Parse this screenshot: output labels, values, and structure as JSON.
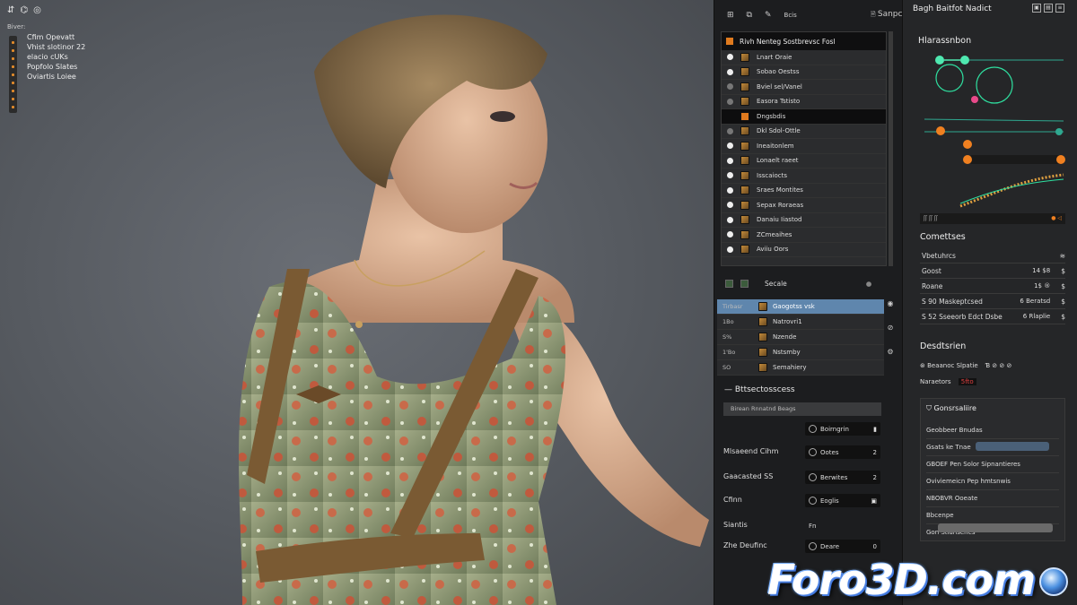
{
  "viewport": {
    "toolbar": [
      "⇵",
      "⌬",
      "◎"
    ],
    "info_header": "Biver:",
    "info_lines": [
      "Cfim Opevatt",
      "Vhist slotinor 22",
      "elacio cUKs",
      "Popfolo Slates",
      "Oviartis Loiee"
    ]
  },
  "outliner": {
    "toolbar_right": "Sanpcr",
    "toolbar_label": "Bcis",
    "list_header": "Rivh Nenteg Sostbrevsc Fosl",
    "rows": [
      {
        "label": "Lnart Oraie",
        "dot": "on"
      },
      {
        "label": "Sobao Oestss",
        "dot": "on"
      },
      {
        "label": "Bviel sel/Vanel",
        "dot": "dim"
      },
      {
        "label": "Easora Tstisto",
        "dot": "dim"
      },
      {
        "label": "Dngsbdis",
        "dot": "none",
        "selected": true
      },
      {
        "label": "Dkl Sdol-Ottle",
        "dot": "dim"
      },
      {
        "label": "Ineaitonlem",
        "dot": "on"
      },
      {
        "label": "Lonaelt raeet",
        "dot": "on"
      },
      {
        "label": "Isscaiocts",
        "dot": "on"
      },
      {
        "label": "Sraes Montites",
        "dot": "on"
      },
      {
        "label": "Sepax Roraeas",
        "dot": "on"
      },
      {
        "label": "Danaiu Iiastod",
        "dot": "on"
      },
      {
        "label": "ZCmeaihes",
        "dot": "on"
      },
      {
        "label": "Aviiu Oors",
        "dot": "on"
      }
    ],
    "subtoolbar_label": "Secale",
    "list2": [
      {
        "num": "Tirbasr",
        "label": "Gaogotss vsk",
        "selected": true
      },
      {
        "num": "1Bo",
        "label": "Natrovri1"
      },
      {
        "num": "S%",
        "label": "Nzende"
      },
      {
        "num": "1'Bo",
        "label": "Nstsmby"
      },
      {
        "num": "SO",
        "label": "Semahiery"
      }
    ],
    "section_title": "Bttsectosscess",
    "section_field": "Birean Rnnatnd Beags",
    "props": [
      {
        "label": "",
        "value": "Boirngrin",
        "end": "▮"
      },
      {
        "label": "Mlsaeend Cihm",
        "value": "Ootes",
        "end": "2"
      },
      {
        "label": "Gaacasted SS",
        "value": "Berwites",
        "end": "2"
      },
      {
        "label": "Cfinn",
        "value": "Eoglis",
        "end": "▣"
      },
      {
        "label": "Siantis",
        "value": "Fn",
        "end": ""
      },
      {
        "label": "Zhe Deufinc",
        "value": "Deare",
        "end": "0"
      }
    ]
  },
  "right": {
    "title": "Bagh Baitfot Nadict",
    "h1": "Hlarassnbon",
    "graph_strip": "ʃʃ ʃʃ ʃʃ",
    "h2": "Comettses",
    "comet_rows": [
      {
        "a": "Vbetuhrcs",
        "b": "",
        "c": "≋"
      },
      {
        "a": "Goost",
        "b": "14  $8",
        "c": "$"
      },
      {
        "a": "Roane",
        "b": "1$  ®",
        "c": "$"
      },
      {
        "a": "S 90   Maskeptcsed",
        "b": "6  Beratsd",
        "c": "$"
      },
      {
        "a": "S 52   Sseeorb Edct Dsbe",
        "b": "6  Rlaplie",
        "c": "$"
      }
    ],
    "h3": "Desdtsrien",
    "d_row1": "Beaanoc Slpatie",
    "d_row2": "Naraetors",
    "d_tag": "5fto",
    "sub_title": "Gonsrsaliire",
    "sub_rows": [
      "Geobbeer Bnudas",
      "Gsats ke Tnae",
      "GBOEF Pen   Solor   Sipnantieres",
      "Oviviemeicn Pep hmtsnwis",
      "NBOBVR Ooeate",
      "Bbcenpe",
      "Gon Stiansenes"
    ]
  },
  "watermark": "Foro3D.com",
  "colors": {
    "selected": "#5f86ad",
    "accent": "#e07a1e",
    "teal": "#2fe0a0"
  }
}
